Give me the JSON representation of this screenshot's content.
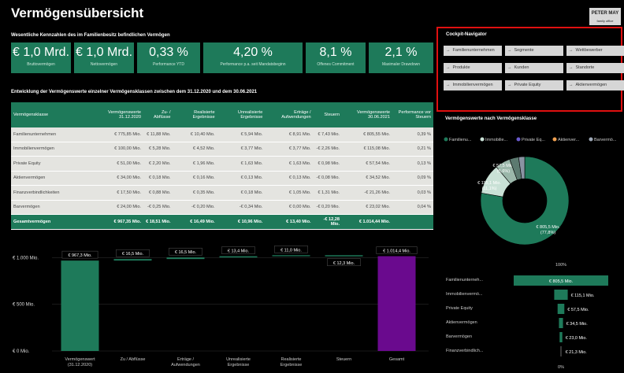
{
  "header": {
    "title": "Vermögensübersicht",
    "logo_line1": "PETER MAY",
    "logo_line2": "family office"
  },
  "kpi_section_title": "Wesentliche Kennzahlen des im Familienbesitz befindlichen Vermögen",
  "kpis": [
    {
      "value": "€ 1,0 Mrd.",
      "label": "Bruttovermögen"
    },
    {
      "value": "€ 1,0 Mrd.",
      "label": "Nettovermögen"
    },
    {
      "value": "0,33 %",
      "label": "Performance YTD"
    },
    {
      "value": "4,20 %",
      "label": "Performance p.a. seit Mandatsbeginn"
    },
    {
      "value": "8,1 %",
      "label": "Offenes Commitment"
    },
    {
      "value": "2,1 %",
      "label": "Maximaler Drawdown"
    }
  ],
  "table_section_title": "Entwicklung der Vermögenswerte einzelner Vermögensklassen zwischen dem 31.12.2020 und dem 30.06.2021",
  "table": {
    "headers": [
      "Vermögensklasse",
      "Vermögenswerte 31.12.2020",
      "Zu- / Abflüsse",
      "Realisierte Ergebnisse",
      "Unrealisierte Ergebnisse",
      "Erträge / Aufwendungen",
      "Steuern",
      "Vermögenswerte 30.06.2021",
      "Performance vor Steuern"
    ],
    "rows": [
      [
        "Familienunternehmen",
        "€ 775,85 Mio.",
        "€ 11,88 Mio.",
        "€ 10,40 Mio.",
        "€ 5,94 Mio.",
        "€ 8,91 Mio.",
        "€ 7,43 Mio.",
        "€ 805,55 Mio.",
        "0,39 %"
      ],
      [
        "Immobilienvermögen",
        "€ 100,00 Mio.",
        "€ 5,28 Mio.",
        "€ 4,52 Mio.",
        "€ 3,77 Mio.",
        "€ 3,77 Mio.",
        "-€ 2,26 Mio.",
        "€ 115,08 Mio.",
        "0,21 %"
      ],
      [
        "Private Equity",
        "€ 51,00 Mio.",
        "€ 2,20 Mio.",
        "€ 1,96 Mio.",
        "€ 1,63 Mio.",
        "€ 1,63 Mio.",
        "€ 0,98 Mio.",
        "€ 57,54 Mio.",
        "0,13 %"
      ],
      [
        "Aktienvermögen",
        "€ 34,00 Mio.",
        "€ 0,18 Mio.",
        "€ 0,16 Mio.",
        "€ 0,13 Mio.",
        "€ 0,13 Mio.",
        "-€ 0,08 Mio.",
        "€ 34,52 Mio.",
        "0,09 %"
      ],
      [
        "Finanzverbindlichkeiten",
        "€ 17,50 Mio.",
        "€ 0,88 Mio.",
        "€ 0,35 Mio.",
        "€ 0,18 Mio.",
        "€ 1,05 Mio.",
        "€ 1,31 Mio.",
        "-€ 21,26 Mio.",
        "0,03 %"
      ],
      [
        "Barvermögen",
        "€ 24,00 Mio.",
        "-€ 0,25 Mio.",
        "-€ 0,20 Mio.",
        "-€ 0,34 Mio.",
        "€ 0,00 Mio.",
        "-€ 0,20 Mio.",
        "€ 23,02 Mio.",
        "0,04 %"
      ]
    ],
    "total": [
      "Gesamtvermögen",
      "€ 967,35 Mio.",
      "€ 18,51 Mio.",
      "€ 16,49 Mio.",
      "€ 10,96 Mio.",
      "€ 13,40 Mio.",
      "-€ 12,28 Mio.",
      "€ 1.014,44 Mio.",
      ""
    ]
  },
  "cockpit": {
    "title": "Cockpit-Navigator",
    "buttons": [
      "Familienunternehmen",
      "Segmente",
      "Wettbewerber",
      "Produkte",
      "Kunden",
      "Standorte",
      "Immobilienvermögen",
      "Private Equity",
      "Aktienvermögen"
    ],
    "arrow": "→"
  },
  "donut_title": "Vermögenswerte nach Vermögensklasse",
  "colors": {
    "green": "#1e7a5a",
    "purple": "#6a0a8e",
    "table_bg": "#e4e4e0",
    "frame": "#e01010"
  },
  "chart_data": [
    {
      "type": "bar",
      "title": "",
      "subtype": "waterfall",
      "categories": [
        "Vermögenswert (31.12.2020)",
        "Zu / Abflüsse",
        "Erträge / Aufwendungen",
        "Unrealisierte Ergebnisse",
        "Realisierte Ergebnisse",
        "Steuern",
        "Gesamt"
      ],
      "values": [
        967.3,
        16.5,
        16.5,
        13.4,
        11.0,
        -12.3,
        1014.4
      ],
      "labels": [
        "€ 967,3 Mio.",
        "€ 16,5 Mio.",
        "€ 16,5 Mio.",
        "€ 13,4 Mio.",
        "€ 11,0 Mio.",
        "€ 12,3 Mio.",
        "€ 1.014,4 Mio."
      ],
      "ytick_labels": [
        "€ 1.000 Mio.",
        "€ 500 Mio.",
        "€ 0 Mio."
      ],
      "yticks": [
        1000,
        500,
        0
      ],
      "ylim": [
        0,
        1120
      ],
      "colors": [
        "#1e7a5a",
        "#1e7a5a",
        "#1e7a5a",
        "#1e7a5a",
        "#1e7a5a",
        "#1e7a5a",
        "#6a0a8e"
      ]
    },
    {
      "type": "pie",
      "title": "Vermögenswerte nach Vermögensklasse",
      "legend": [
        "Familienu...",
        "Immobilie...",
        "Private Eq...",
        "Aktienver...",
        "Barvermö..."
      ],
      "legend_colors": [
        "#1e7a5a",
        "#c9e1d6",
        "#6a5acd",
        "#f0a050",
        "#9fa9b8"
      ],
      "values": [
        805.5,
        115.1,
        57.5,
        34.5,
        23.0
      ],
      "labels": [
        "€ 805,5 Mio. (77,8%)",
        "€ 115,1 Mio. (11,1%)",
        "€ 57,5 Mio. (5,6%)",
        "",
        ""
      ],
      "colors": [
        "#1e7a5a",
        "#c9e1d6",
        "#9bb7aa",
        "#5c7a70",
        "#8a94a3"
      ]
    },
    {
      "type": "bar",
      "title": "",
      "orientation": "horizontal",
      "subtype": "funnel",
      "top_label": "100%",
      "bottom_label": "0%",
      "categories": [
        "Familienunterneh...",
        "Immobilienvermö...",
        "Private Equity",
        "Aktienvermögen",
        "Barvermögen",
        "Finanzverbindlich..."
      ],
      "values": [
        805.5,
        115.1,
        57.5,
        34.5,
        23.0,
        21.3
      ],
      "labels": [
        "€ 805,5 Mio.",
        "€ 115,1 Mio.",
        "€ 57,5 Mio.",
        "€ 34,5 Mio.",
        "€ 23,0 Mio.",
        "€ 21,3 Mio."
      ]
    }
  ]
}
